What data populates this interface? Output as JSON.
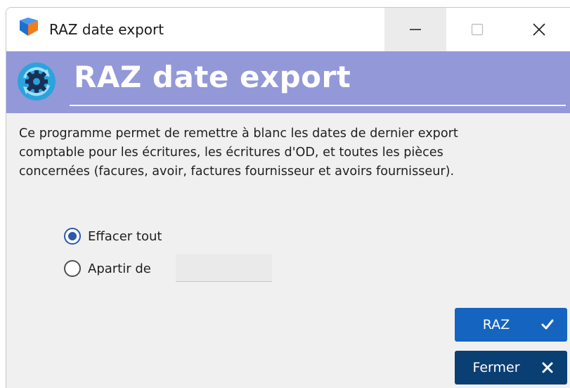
{
  "window": {
    "title": "RAZ date export"
  },
  "header": {
    "title": "RAZ date export"
  },
  "description": {
    "lines": [
      "Ce programme permet de remettre à blanc les dates de dernier export",
      "comptable pour les écritures, les écritures d'OD, et toutes les pièces",
      "concernées (facures, avoir, factures fournisseur et avoirs fournisseur)."
    ]
  },
  "options": {
    "erase_all": {
      "label": "Effacer tout",
      "selected": true
    },
    "from_date": {
      "label": "Apartir de",
      "selected": false,
      "value": ""
    }
  },
  "actions": {
    "raz_label": "RAZ",
    "close_label": "Fermer"
  },
  "icons": {
    "app": "app-logo-icon",
    "header": "refresh-gear-icon",
    "minimize": "minimize-icon",
    "maximize": "maximize-icon",
    "close": "close-icon",
    "raz": "checkmark-icon",
    "fermer": "x-icon"
  },
  "colors": {
    "header_band": "#9398d8",
    "primary_button": "#1565c0",
    "secondary_button": "#0a3f73",
    "radio_accent": "#2b5aa8"
  }
}
